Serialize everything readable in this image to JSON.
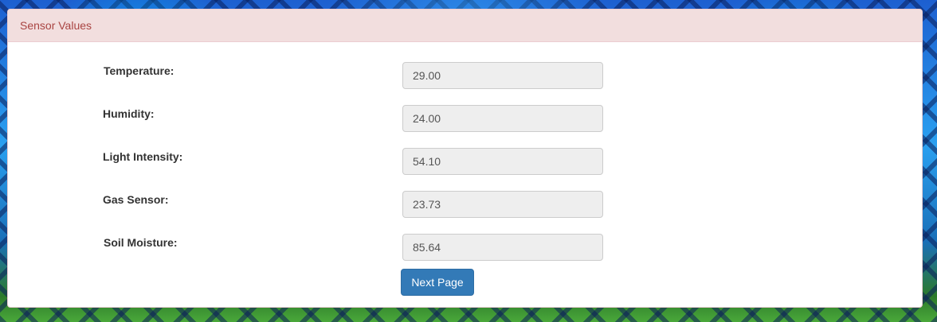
{
  "panel": {
    "title": "Sensor Values"
  },
  "fields": [
    {
      "label": "Temperature:",
      "value": "29.00"
    },
    {
      "label": "Humidity:",
      "value": "24.00"
    },
    {
      "label": "Light Intensity:",
      "value": "54.10"
    },
    {
      "label": "Gas Sensor:",
      "value": "23.73"
    },
    {
      "label": "Soil Moisture:",
      "value": "85.64"
    }
  ],
  "actions": {
    "next_label": "Next Page"
  },
  "colors": {
    "heading_bg": "#f2dede",
    "heading_text": "#a94442",
    "button_bg": "#337ab7",
    "input_bg": "#eeeeee"
  }
}
